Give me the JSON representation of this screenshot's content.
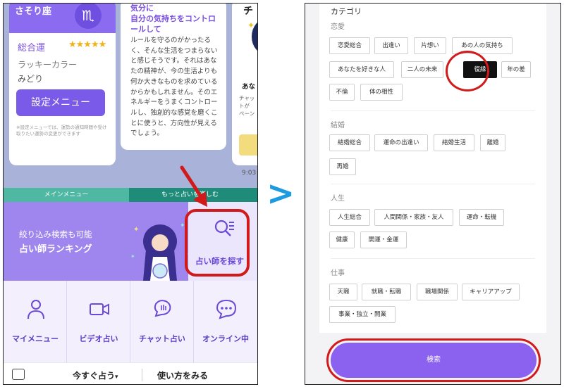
{
  "left_phone": {
    "card1": {
      "sign": "さそり座",
      "badge_symbol": "♏",
      "overall_label": "総合運",
      "stars": "★★★★★",
      "lucky_label": "ラッキーカラー",
      "lucky_value": "みどり",
      "settings_button": "設定メニュー",
      "note": "※設定メニューでは、運勢の通知時間や受け取りたい運勢の変更ができます"
    },
    "card2": {
      "title": "気分に\n自分の気持ちをコントロールして",
      "body": "ルールを守るのがかったるく、そんな生活をつまらないと感じそうです。それはあなたの精神が、今の生活よりも何か大きなものを求めているからかもしれません。そのエネルギーをうまくコントロールし、独創的な感覚を磨くことに使うと、方向性が見えるでしょう。"
    },
    "card3": {
      "title": "チ",
      "text": "あな",
      "sub": "チャッ\nトが\nペーン"
    },
    "clock": "9:03",
    "tabs": {
      "main": "メインメニュー",
      "more": "もっと占いを楽しむ"
    },
    "banner": {
      "sub": "絞り込み検索も可能",
      "main": "占い師ランキング"
    },
    "find_button": "占い師を探す",
    "grid": [
      {
        "label": "マイメニュー",
        "icon": "person-icon"
      },
      {
        "label": "ビデオ占い",
        "icon": "video-camera-icon"
      },
      {
        "label": "チャット占い",
        "icon": "chat-hand-icon"
      },
      {
        "label": "オンライン中",
        "icon": "chat-bubble-icon"
      }
    ],
    "bottom": {
      "now": "今すぐ占う",
      "caret": "▾",
      "how": "使い方をみる"
    }
  },
  "arrow_between": ">",
  "right_phone": {
    "category_title": "カテゴリ",
    "sections": {
      "love": {
        "title": "恋愛",
        "chips": [
          "恋愛総合",
          "出逢い",
          "片想い",
          "あの人の気持ち",
          "あなたを好きな人",
          "二人の未来",
          "復縁",
          "年の差",
          "不倫",
          "体の相性"
        ]
      },
      "marriage": {
        "title": "結婚",
        "chips": [
          "結婚総合",
          "運命の出逢い",
          "結婚生活",
          "離婚",
          "再婚"
        ]
      },
      "life": {
        "title": "人生",
        "chips": [
          "人生総合",
          "人間関係・家族・友人",
          "運命・転機",
          "健康",
          "開運・金運"
        ]
      },
      "work": {
        "title": "仕事",
        "chips": [
          "天職",
          "就職・転職",
          "職場関係",
          "キャリアアップ",
          "事業・独立・開業"
        ]
      }
    },
    "selected_chip": "復縁",
    "search_button": "検索"
  },
  "colors": {
    "accent_purple": "#8b62f0",
    "annotation_red": "#d11a1a",
    "chevron_blue": "#1e9be0",
    "teal": "#4fb8a3"
  }
}
